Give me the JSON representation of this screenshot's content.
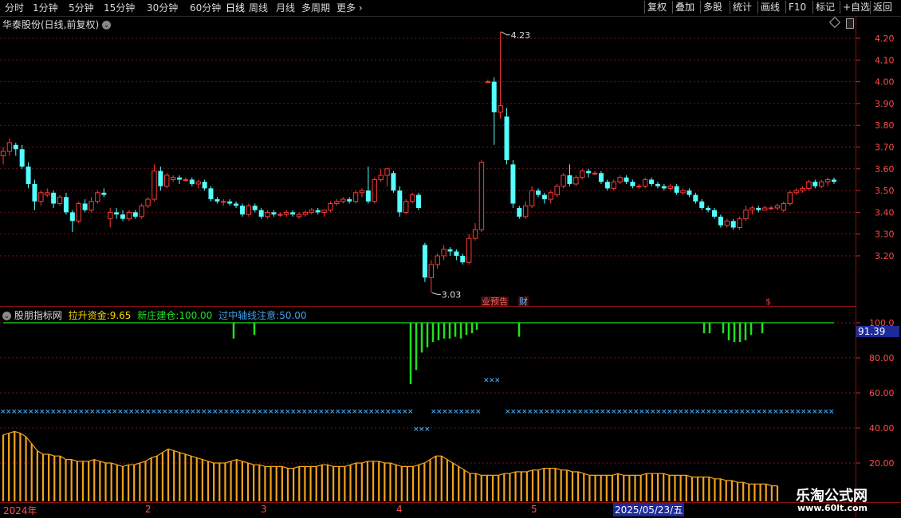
{
  "topbar": {
    "periods": [
      "分时",
      "1分钟",
      "5分钟",
      "15分钟",
      "30分钟",
      "60分钟",
      "日线",
      "周线",
      "月线",
      "多周期",
      "更多"
    ],
    "active_period": "日线",
    "tools": [
      "复权",
      "叠加",
      "多股",
      "统计",
      "画线",
      "F10",
      "标记",
      "+自选",
      "返回"
    ]
  },
  "chart_title": "华泰股份(日线,前复权)",
  "indicator": {
    "name": "股朋指标网",
    "lines": [
      {
        "label": "拉升资金:",
        "value": "9.65",
        "color": "#ffd700"
      },
      {
        "label": "新庄建仓:",
        "value": "100.00",
        "color": "#22e022"
      },
      {
        "label": "过中轴线注意:",
        "value": "50.00",
        "color": "#3fa0e8"
      }
    ],
    "current_value": "91.39"
  },
  "price_axis": [
    "4.20",
    "4.10",
    "4.00",
    "3.90",
    "3.80",
    "3.70",
    "3.60",
    "3.50",
    "3.40",
    "3.30",
    "3.20"
  ],
  "indicator_axis": [
    "100.0",
    "80.00",
    "60.00",
    "40.00",
    "20.00"
  ],
  "annotations": {
    "high": "4.23",
    "low": "3.03"
  },
  "event_markers": [
    {
      "text": "业绩",
      "color": "#ff6060"
    },
    {
      "text": "预告",
      "color": "#ff6060"
    },
    {
      "text": "财",
      "color": "#5fb8ff"
    },
    {
      "text": "$",
      "color": "#ff3030"
    }
  ],
  "date_axis": {
    "year": "2024年",
    "months": [
      "2",
      "3",
      "4",
      "5"
    ],
    "cursor_date": "2025/05/23/五"
  },
  "watermark": {
    "line1": "乐淘公式网",
    "line2": "www.60lt.com"
  },
  "chart_data": {
    "type": "candlestick",
    "price_ylim": [
      3.0,
      4.27
    ],
    "indicator_ylim": [
      0,
      105
    ],
    "candles": [
      [
        3.66,
        3.7,
        3.62,
        3.68
      ],
      [
        3.68,
        3.74,
        3.66,
        3.72
      ],
      [
        3.71,
        3.72,
        3.66,
        3.69
      ],
      [
        3.69,
        3.71,
        3.6,
        3.61
      ],
      [
        3.61,
        3.63,
        3.51,
        3.53
      ],
      [
        3.53,
        3.55,
        3.41,
        3.45
      ],
      [
        3.45,
        3.5,
        3.43,
        3.49
      ],
      [
        3.48,
        3.51,
        3.47,
        3.49
      ],
      [
        3.49,
        3.5,
        3.42,
        3.44
      ],
      [
        3.44,
        3.48,
        3.43,
        3.47
      ],
      [
        3.47,
        3.49,
        3.39,
        3.4
      ],
      [
        3.4,
        3.41,
        3.31,
        3.36
      ],
      [
        3.36,
        3.45,
        3.35,
        3.44
      ],
      [
        3.44,
        3.46,
        3.4,
        3.41
      ],
      [
        3.41,
        3.47,
        3.4,
        3.45
      ],
      [
        3.45,
        3.5,
        3.44,
        3.49
      ],
      [
        3.49,
        3.51,
        3.47,
        3.48
      ],
      [
        3.37,
        3.42,
        3.33,
        3.4
      ],
      [
        3.4,
        3.42,
        3.37,
        3.39
      ],
      [
        3.39,
        3.41,
        3.36,
        3.37
      ],
      [
        3.37,
        3.41,
        3.36,
        3.4
      ],
      [
        3.4,
        3.41,
        3.37,
        3.38
      ],
      [
        3.38,
        3.44,
        3.37,
        3.43
      ],
      [
        3.43,
        3.47,
        3.42,
        3.46
      ],
      [
        3.46,
        3.62,
        3.45,
        3.59
      ],
      [
        3.59,
        3.61,
        3.5,
        3.52
      ],
      [
        3.52,
        3.58,
        3.51,
        3.57
      ],
      [
        3.55,
        3.57,
        3.54,
        3.56
      ],
      [
        3.56,
        3.57,
        3.53,
        3.55
      ],
      [
        3.55,
        3.56,
        3.54,
        3.55
      ],
      [
        3.55,
        3.56,
        3.52,
        3.53
      ],
      [
        3.53,
        3.55,
        3.51,
        3.54
      ],
      [
        3.54,
        3.55,
        3.5,
        3.51
      ],
      [
        3.51,
        3.52,
        3.45,
        3.46
      ],
      [
        3.46,
        3.47,
        3.44,
        3.45
      ],
      [
        3.45,
        3.46,
        3.43,
        3.45
      ],
      [
        3.45,
        3.46,
        3.43,
        3.44
      ],
      [
        3.44,
        3.45,
        3.42,
        3.43
      ],
      [
        3.43,
        3.44,
        3.38,
        3.39
      ],
      [
        3.39,
        3.44,
        3.38,
        3.43
      ],
      [
        3.43,
        3.44,
        3.4,
        3.41
      ],
      [
        3.41,
        3.42,
        3.37,
        3.38
      ],
      [
        3.38,
        3.41,
        3.37,
        3.4
      ],
      [
        3.4,
        3.41,
        3.38,
        3.39
      ],
      [
        3.39,
        3.4,
        3.38,
        3.39
      ],
      [
        3.39,
        3.41,
        3.38,
        3.4
      ],
      [
        3.4,
        3.41,
        3.38,
        3.39
      ],
      [
        3.38,
        3.4,
        3.37,
        3.39
      ],
      [
        3.39,
        3.41,
        3.38,
        3.4
      ],
      [
        3.4,
        3.42,
        3.39,
        3.41
      ],
      [
        3.41,
        3.42,
        3.39,
        3.4
      ],
      [
        3.4,
        3.41,
        3.38,
        3.41
      ],
      [
        3.41,
        3.45,
        3.4,
        3.44
      ],
      [
        3.44,
        3.46,
        3.43,
        3.45
      ],
      [
        3.45,
        3.47,
        3.44,
        3.46
      ],
      [
        3.46,
        3.47,
        3.44,
        3.45
      ],
      [
        3.45,
        3.5,
        3.44,
        3.49
      ],
      [
        3.49,
        3.51,
        3.47,
        3.5
      ],
      [
        3.5,
        3.61,
        3.44,
        3.45
      ],
      [
        3.45,
        3.56,
        3.44,
        3.55
      ],
      [
        3.55,
        3.6,
        3.54,
        3.57
      ],
      [
        3.57,
        3.6,
        3.52,
        3.6
      ],
      [
        3.58,
        3.59,
        3.49,
        3.5
      ],
      [
        3.5,
        3.52,
        3.38,
        3.4
      ],
      [
        3.4,
        3.46,
        3.39,
        3.45
      ],
      [
        3.45,
        3.49,
        3.44,
        3.48
      ],
      [
        3.48,
        3.49,
        3.41,
        3.42
      ],
      [
        3.25,
        3.26,
        3.08,
        3.1
      ],
      [
        3.1,
        3.18,
        3.03,
        3.16
      ],
      [
        3.16,
        3.21,
        3.14,
        3.2
      ],
      [
        3.2,
        3.25,
        3.18,
        3.23
      ],
      [
        3.23,
        3.24,
        3.2,
        3.22
      ],
      [
        3.22,
        3.23,
        3.18,
        3.2
      ],
      [
        3.2,
        3.21,
        3.16,
        3.17
      ],
      [
        3.17,
        3.3,
        3.16,
        3.28
      ],
      [
        3.28,
        3.35,
        3.27,
        3.32
      ],
      [
        3.32,
        3.64,
        3.31,
        3.63
      ],
      [
        4.0,
        4.01,
        4.0,
        4.0
      ],
      [
        4.0,
        4.02,
        3.71,
        3.86
      ],
      [
        3.86,
        4.23,
        3.83,
        3.89
      ],
      [
        3.84,
        3.88,
        3.62,
        3.64
      ],
      [
        3.62,
        3.64,
        3.42,
        3.44
      ],
      [
        3.42,
        3.43,
        3.37,
        3.38
      ],
      [
        3.38,
        3.45,
        3.37,
        3.43
      ],
      [
        3.43,
        3.52,
        3.42,
        3.5
      ],
      [
        3.5,
        3.51,
        3.47,
        3.48
      ],
      [
        3.48,
        3.49,
        3.44,
        3.46
      ],
      [
        3.46,
        3.5,
        3.44,
        3.49
      ],
      [
        3.48,
        3.53,
        3.47,
        3.52
      ],
      [
        3.52,
        3.58,
        3.51,
        3.57
      ],
      [
        3.57,
        3.62,
        3.52,
        3.53
      ],
      [
        3.53,
        3.57,
        3.52,
        3.56
      ],
      [
        3.56,
        3.6,
        3.55,
        3.59
      ],
      [
        3.59,
        3.6,
        3.56,
        3.58
      ],
      [
        3.58,
        3.59,
        3.57,
        3.58
      ],
      [
        3.58,
        3.59,
        3.53,
        3.54
      ],
      [
        3.54,
        3.55,
        3.5,
        3.51
      ],
      [
        3.51,
        3.55,
        3.5,
        3.54
      ],
      [
        3.54,
        3.57,
        3.53,
        3.56
      ],
      [
        3.56,
        3.57,
        3.53,
        3.54
      ],
      [
        3.54,
        3.55,
        3.51,
        3.52
      ],
      [
        3.52,
        3.53,
        3.51,
        3.52
      ],
      [
        3.52,
        3.56,
        3.51,
        3.55
      ],
      [
        3.55,
        3.56,
        3.52,
        3.53
      ],
      [
        3.53,
        3.54,
        3.51,
        3.52
      ],
      [
        3.52,
        3.53,
        3.5,
        3.51
      ],
      [
        3.51,
        3.53,
        3.5,
        3.52
      ],
      [
        3.52,
        3.53,
        3.48,
        3.49
      ],
      [
        3.49,
        3.51,
        3.48,
        3.5
      ],
      [
        3.5,
        3.51,
        3.47,
        3.48
      ],
      [
        3.48,
        3.49,
        3.44,
        3.45
      ],
      [
        3.45,
        3.46,
        3.41,
        3.42
      ],
      [
        3.42,
        3.43,
        3.4,
        3.41
      ],
      [
        3.41,
        3.42,
        3.37,
        3.38
      ],
      [
        3.38,
        3.39,
        3.33,
        3.34
      ],
      [
        3.34,
        3.37,
        3.33,
        3.36
      ],
      [
        3.36,
        3.37,
        3.32,
        3.33
      ],
      [
        3.33,
        3.38,
        3.32,
        3.37
      ],
      [
        3.37,
        3.43,
        3.36,
        3.41
      ],
      [
        3.41,
        3.43,
        3.39,
        3.42
      ],
      [
        3.42,
        3.43,
        3.4,
        3.41
      ],
      [
        3.41,
        3.43,
        3.41,
        3.42
      ],
      [
        3.42,
        3.43,
        3.41,
        3.42
      ],
      [
        3.42,
        3.44,
        3.41,
        3.43
      ],
      [
        3.41,
        3.45,
        3.4,
        3.44
      ],
      [
        3.44,
        3.5,
        3.43,
        3.49
      ],
      [
        3.49,
        3.51,
        3.48,
        3.5
      ],
      [
        3.5,
        3.52,
        3.49,
        3.51
      ],
      [
        3.51,
        3.55,
        3.5,
        3.54
      ],
      [
        3.54,
        3.55,
        3.51,
        3.52
      ],
      [
        3.52,
        3.55,
        3.51,
        3.54
      ],
      [
        3.54,
        3.56,
        3.52,
        3.55
      ],
      [
        3.55,
        3.56,
        3.53,
        3.54
      ]
    ],
    "green_line": [
      100,
      100,
      100,
      100,
      100,
      100,
      100,
      100,
      100,
      100,
      100,
      100,
      100,
      100,
      100,
      100,
      100,
      100,
      100,
      100,
      100,
      100,
      100,
      100,
      100,
      100,
      100,
      100,
      100,
      100,
      100,
      100,
      100,
      100,
      100,
      100,
      100,
      100,
      100,
      100,
      100,
      100,
      100,
      100,
      100,
      100,
      100,
      100,
      100,
      100,
      100,
      100,
      100,
      100,
      100,
      100,
      100,
      100,
      100,
      100,
      100,
      100,
      100,
      100,
      100,
      100,
      100,
      100,
      100,
      100,
      100,
      100,
      100,
      100,
      100,
      100,
      100,
      100,
      100,
      100,
      100,
      100,
      100,
      100,
      100,
      100,
      100,
      100,
      100,
      100,
      100,
      100,
      100,
      100,
      100,
      100,
      100,
      100,
      100,
      100,
      100,
      100,
      100,
      100,
      100,
      100,
      100,
      100,
      100,
      100,
      100,
      100,
      100,
      100,
      100,
      100,
      100,
      100,
      100,
      100,
      100,
      100,
      100,
      100,
      100,
      100,
      100,
      100,
      100,
      100,
      100,
      100,
      100
    ],
    "yellow_bars": [
      36,
      37,
      38,
      37,
      35,
      31,
      27,
      25,
      25,
      24,
      24,
      22,
      22,
      21,
      21,
      21,
      22,
      21,
      20,
      20,
      19,
      18,
      19,
      19,
      20,
      21,
      23,
      24,
      26,
      28,
      27,
      26,
      25,
      24,
      23,
      22,
      21,
      20,
      20,
      20,
      21,
      22,
      21,
      20,
      19,
      19,
      18,
      18,
      18,
      18,
      17,
      17,
      18,
      18,
      18,
      18,
      19,
      19,
      18,
      18,
      18,
      19,
      20,
      20,
      21,
      21,
      21,
      20,
      20,
      19,
      18,
      18,
      18,
      19,
      20,
      22,
      24,
      24,
      22,
      20,
      18,
      16,
      14,
      14,
      13,
      13,
      13,
      13,
      14,
      14,
      15,
      15,
      15,
      16,
      16,
      17,
      17,
      17,
      16,
      16,
      15,
      15,
      14,
      13,
      13,
      13,
      13,
      13,
      14,
      13,
      13,
      13,
      13,
      14,
      14,
      14,
      14,
      13,
      13,
      13,
      13,
      12,
      12,
      12,
      12,
      11,
      11,
      10,
      10,
      9,
      9,
      8,
      8,
      8,
      8,
      7,
      7
    ],
    "cross_levels": [
      50,
      40,
      68
    ]
  }
}
